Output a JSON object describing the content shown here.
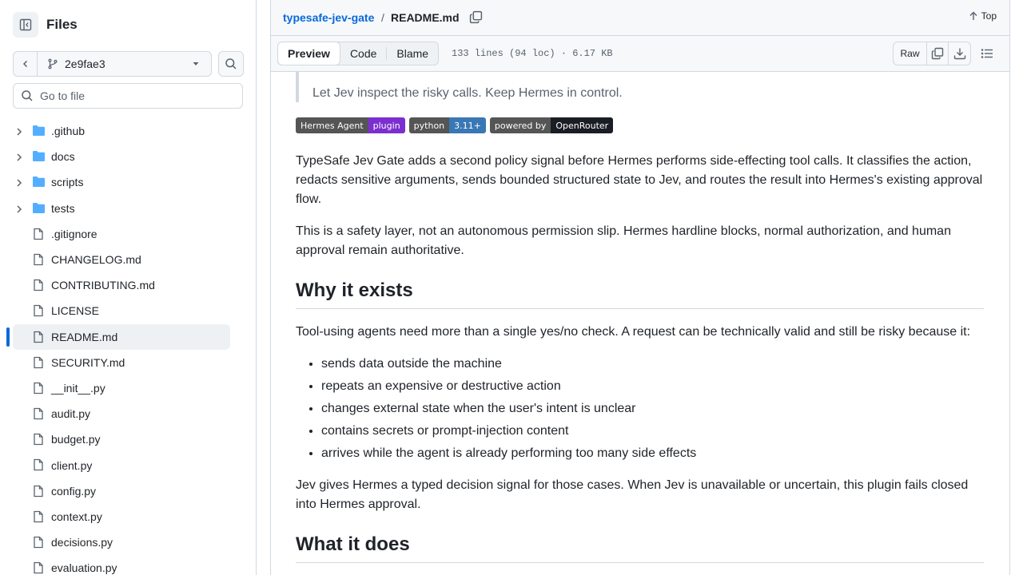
{
  "sidebar": {
    "title": "Files",
    "branch": "2e9fae3",
    "goto_placeholder": "Go to file",
    "items": [
      {
        "name": ".github",
        "type": "folder"
      },
      {
        "name": "docs",
        "type": "folder"
      },
      {
        "name": "scripts",
        "type": "folder"
      },
      {
        "name": "tests",
        "type": "folder"
      },
      {
        "name": ".gitignore",
        "type": "file"
      },
      {
        "name": "CHANGELOG.md",
        "type": "file"
      },
      {
        "name": "CONTRIBUTING.md",
        "type": "file"
      },
      {
        "name": "LICENSE",
        "type": "file"
      },
      {
        "name": "README.md",
        "type": "file",
        "selected": true
      },
      {
        "name": "SECURITY.md",
        "type": "file"
      },
      {
        "name": "__init__.py",
        "type": "file"
      },
      {
        "name": "audit.py",
        "type": "file"
      },
      {
        "name": "budget.py",
        "type": "file"
      },
      {
        "name": "client.py",
        "type": "file"
      },
      {
        "name": "config.py",
        "type": "file"
      },
      {
        "name": "context.py",
        "type": "file"
      },
      {
        "name": "decisions.py",
        "type": "file"
      },
      {
        "name": "evaluation.py",
        "type": "file"
      }
    ]
  },
  "header": {
    "repo": "typesafe-jev-gate",
    "separator": "/",
    "file": "README.md",
    "top_label": "Top"
  },
  "file_bar": {
    "tabs": {
      "preview": "Preview",
      "code": "Code",
      "blame": "Blame"
    },
    "stats": "133 lines (94 loc) · 6.17 KB",
    "raw": "Raw"
  },
  "readme": {
    "quote": "Let Jev inspect the risky calls. Keep Hermes in control.",
    "badges": [
      {
        "left": "Hermes Agent",
        "right": "plugin",
        "right_color": "#7b2fd0"
      },
      {
        "left": "python",
        "right": "3.11+",
        "right_color": "#3a77b5"
      },
      {
        "left": "powered by",
        "right": "OpenRouter",
        "right_color": "#1a1d24"
      }
    ],
    "para1": "TypeSafe Jev Gate adds a second policy signal before Hermes performs side-effecting tool calls. It classifies the action, redacts sensitive arguments, sends bounded structured state to Jev, and routes the result into Hermes's existing approval flow.",
    "para2": "This is a safety layer, not an autonomous permission slip. Hermes hardline blocks, normal authorization, and human approval remain authoritative.",
    "h_why": "Why it exists",
    "para3": "Tool-using agents need more than a single yes/no check. A request can be technically valid and still be risky because it:",
    "bullets": [
      "sends data outside the machine",
      "repeats an expensive or destructive action",
      "changes external state when the user's intent is unclear",
      "contains secrets or prompt-injection content",
      "arrives while the agent is already performing too many side effects"
    ],
    "para4": "Jev gives Hermes a typed decision signal for those cases. When Jev is unavailable or uncertain, this plugin fails closed into Hermes approval.",
    "h_what": "What it does"
  }
}
